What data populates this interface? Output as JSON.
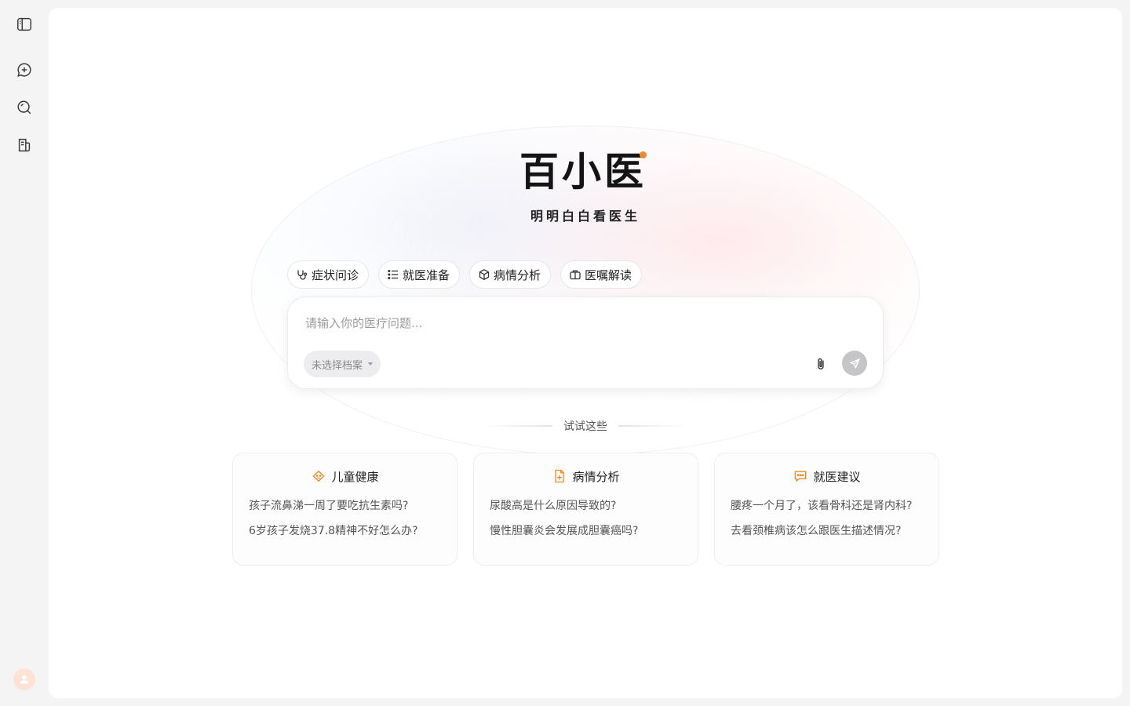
{
  "sidebar": {
    "items": [
      {
        "name": "toggle-sidebar",
        "icon": "sidebar-panel-icon"
      },
      {
        "name": "new-chat",
        "icon": "chat-plus-icon"
      },
      {
        "name": "search",
        "icon": "search-icon"
      },
      {
        "name": "records",
        "icon": "document-icon"
      }
    ],
    "avatar_icon": "user-icon"
  },
  "brand": {
    "logo_text": "百小医",
    "slogan": "明明白白看医生",
    "accent_color": "#f08a24"
  },
  "chips": [
    {
      "label": "症状问诊",
      "icon": "stethoscope-icon"
    },
    {
      "label": "就医准备",
      "icon": "checklist-icon"
    },
    {
      "label": "病情分析",
      "icon": "cube-icon"
    },
    {
      "label": "医嘱解读",
      "icon": "briefcase-icon"
    }
  ],
  "input": {
    "value": "",
    "placeholder": "请输入你的医疗问题...",
    "profile_select": "未选择档案"
  },
  "suggestions": {
    "heading": "试试这些",
    "cards": [
      {
        "title": "儿童健康",
        "icon": "child-face-icon",
        "questions": [
          "孩子流鼻涕一周了要吃抗生素吗?",
          "6岁孩子发烧37.8精神不好怎么办?"
        ]
      },
      {
        "title": "病情分析",
        "icon": "medical-file-icon",
        "questions": [
          "尿酸高是什么原因导致的?",
          "慢性胆囊炎会发展成胆囊癌吗?"
        ]
      },
      {
        "title": "就医建议",
        "icon": "chat-bubble-icon",
        "questions": [
          "腰疼一个月了，该看骨科还是肾内科?",
          "去看颈椎病该怎么跟医生描述情况?"
        ]
      }
    ]
  }
}
